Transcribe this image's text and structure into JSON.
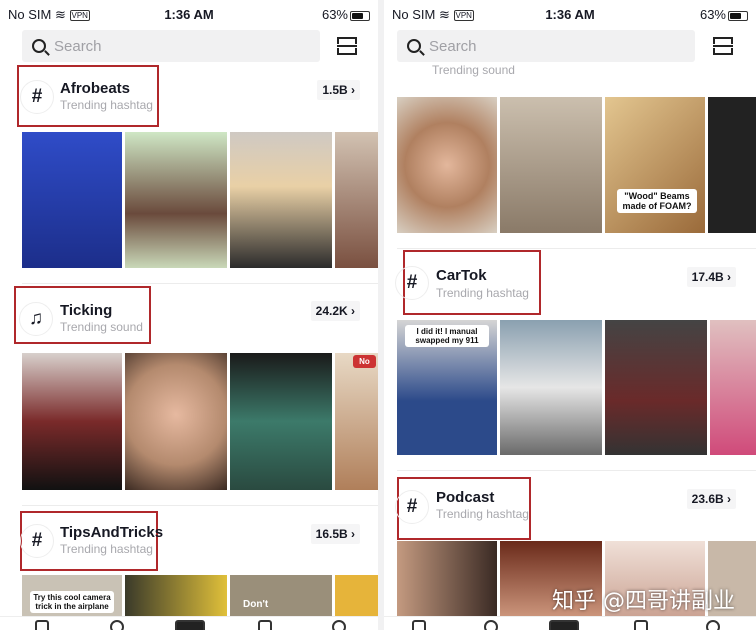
{
  "status": {
    "carrier": "No SIM",
    "vpn": "VPN",
    "time": "1:36 AM",
    "battery": "63%",
    "battery_level": 0.63
  },
  "search": {
    "placeholder": "Search"
  },
  "left": {
    "sections": [
      {
        "icon": "hashtag-icon",
        "glyph": "#",
        "title": "Afrobeats",
        "subtitle": "Trending hashtag",
        "count": "1.5B ›"
      },
      {
        "icon": "music-note-icon",
        "glyph": "♫",
        "title": "Ticking",
        "subtitle": "Trending sound",
        "count": "24.2K ›"
      },
      {
        "icon": "hashtag-icon",
        "glyph": "#",
        "title": "TipsAndTricks",
        "subtitle": "Trending hashtag",
        "count": "16.5B ›"
      }
    ],
    "captions": {
      "tips1": "Try this cool camera trick in the airplane",
      "tips3": "Don't",
      "tick4": "No"
    }
  },
  "right": {
    "partial_subtitle": "Trending sound",
    "sections": [
      {
        "icon": "hashtag-icon",
        "glyph": "#",
        "title": "CarTok",
        "subtitle": "Trending hashtag",
        "count": "17.4B ›"
      },
      {
        "icon": "hashtag-icon",
        "glyph": "#",
        "title": "Podcast",
        "subtitle": "Trending hashtag",
        "count": "23.6B ›"
      }
    ],
    "captions": {
      "wood": "\"Wood\" Beams made of FOAM?",
      "car1": "I did it! I manual swapped my 911"
    }
  },
  "watermark": "知乎 @四哥讲副业",
  "colors": {
    "highlight_box": "#b0282b"
  }
}
